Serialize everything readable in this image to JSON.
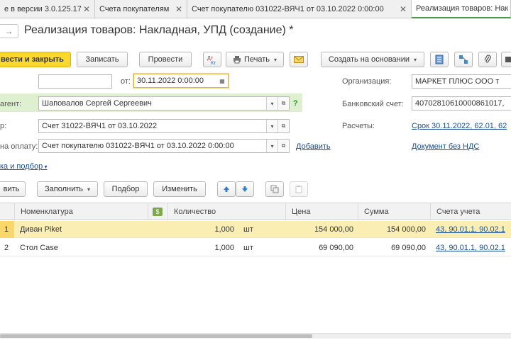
{
  "tabs": [
    {
      "label": "е в версии 3.0.125.17"
    },
    {
      "label": "Счета покупателям"
    },
    {
      "label": "Счет покупателю 031022-ВЯЧ1 от 03.10.2022 0:00:00"
    },
    {
      "label": "Реализация товаров: Нак"
    }
  ],
  "title": "Реализация товаров: Накладная, УПД (создание) *",
  "toolbar": {
    "post_close": "вести и закрыть",
    "save": "Записать",
    "post": "Провести",
    "print": "Печать",
    "create_based": "Создать на основании"
  },
  "form": {
    "number_value": "",
    "date_label": "от:",
    "date_value": "30.11.2022  0:00:00",
    "counterparty_label": "агент:",
    "counterparty_value": "Шаповалов Сергей Сергеевич",
    "help": "?",
    "contract_label": "р:",
    "contract_value": "Счет 31022-ВЯЧ1 от 03.10.2022",
    "invoice_label": "на оплату:",
    "invoice_value": "Счет покупателю 031022-ВЯЧ1 от 03.10.2022 0:00:00",
    "add_link": "Добавить",
    "org_label": "Организация:",
    "org_value": "МАРКЕТ ПЛЮС ООО т",
    "bank_label": "Банковский счет:",
    "bank_value": "40702810610000861017,",
    "calc_label": "Расчеты:",
    "calc_link": "Срок 30.11.2022, 62.01, 62",
    "vat_link": "Документ без НДС",
    "pick_link": "ка и подбор"
  },
  "table_toolbar": {
    "add": "вить",
    "fill": "Заполнить",
    "pick": "Подбор",
    "change": "Изменить"
  },
  "table": {
    "headers": [
      "Номенклатура",
      "Количество",
      "Цена",
      "Сумма",
      "Счета учета"
    ],
    "rows": [
      {
        "n": "1",
        "name": "Диван Piket",
        "qty": "1,000",
        "unit": "шт",
        "price": "154 000,00",
        "sum": "154 000,00",
        "accounts": "43, 90.01.1, 90.02.1"
      },
      {
        "n": "2",
        "name": "Стол Case",
        "qty": "1,000",
        "unit": "шт",
        "price": "69 090,00",
        "sum": "69 090,00",
        "accounts": "43, 90.01.1, 90.02.1"
      }
    ]
  }
}
